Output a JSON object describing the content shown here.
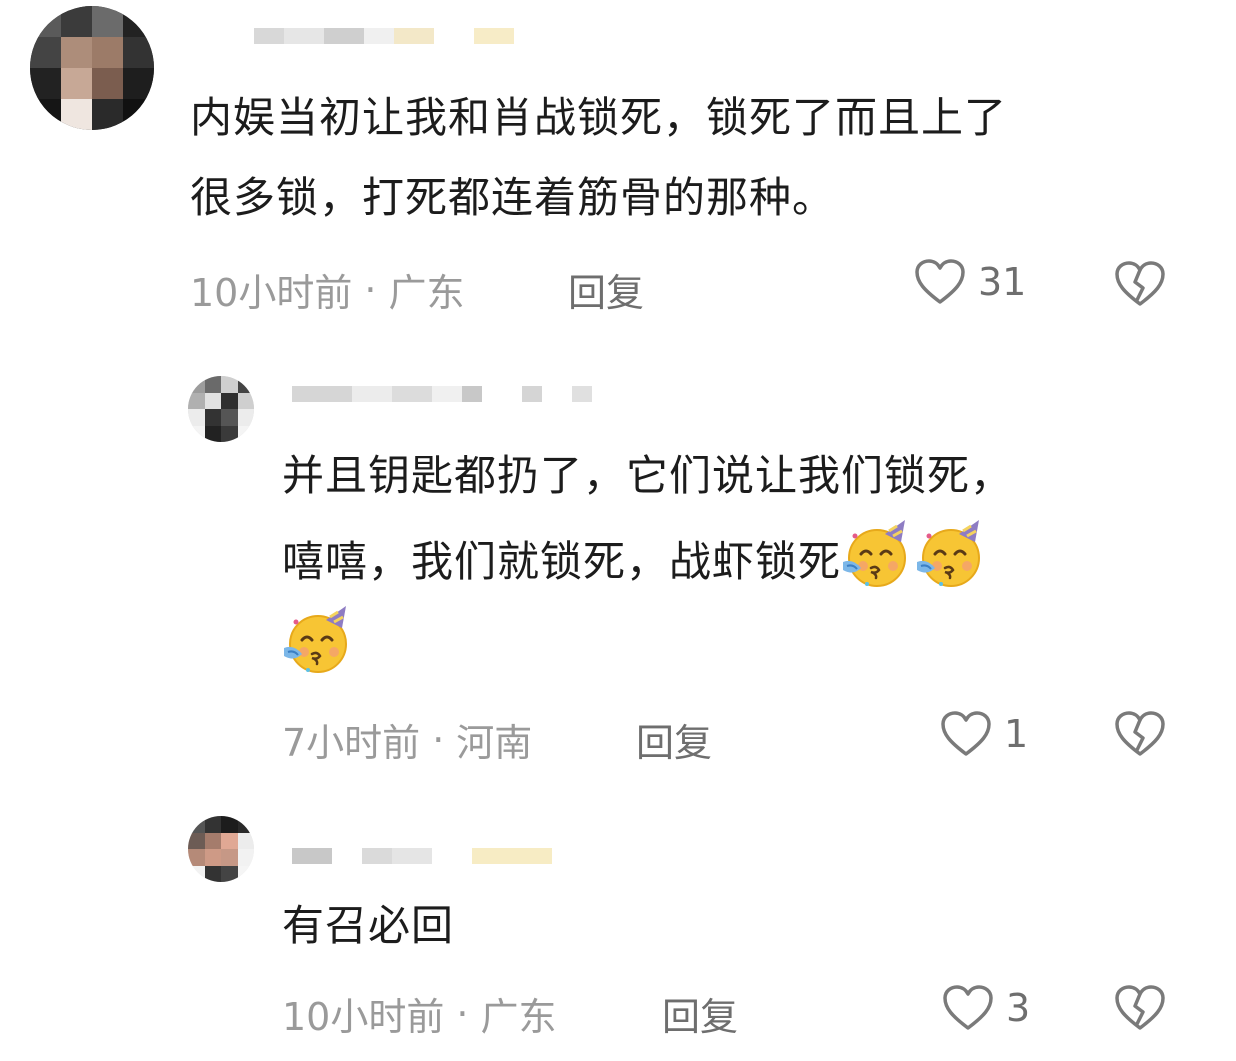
{
  "comments": [
    {
      "text_lines": [
        "内娱当初让我和肖战锁死，锁死了而且上了",
        "很多锁，打死都连着筋骨的那种。"
      ],
      "time": "10小时前",
      "location": "广东",
      "reply_label": "回复",
      "likes": "31"
    },
    {
      "text_lines": [
        "并且钥匙都扔了，它们说让我们锁死，",
        "嘻嘻，我们就锁死，战虾锁死"
      ],
      "emojis": [
        "partying-face",
        "partying-face",
        "partying-face"
      ],
      "time": "7小时前",
      "location": "河南",
      "reply_label": "回复",
      "likes": "1"
    },
    {
      "text_lines": [
        "有召必回"
      ],
      "time": "10小时前",
      "location": "广东",
      "reply_label": "回复",
      "likes": "3"
    }
  ],
  "separator": "·",
  "icons": {
    "like": "heart-outline-icon",
    "dislike": "broken-heart-icon"
  },
  "colors": {
    "meta": "#9a9a9a",
    "action": "#6e6e6e",
    "text": "#1c1c1c"
  }
}
